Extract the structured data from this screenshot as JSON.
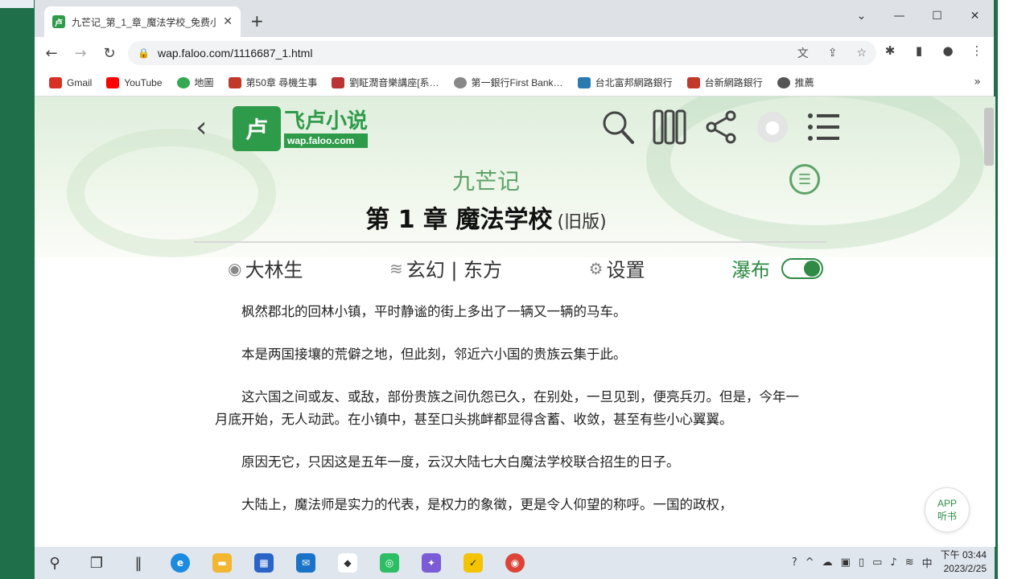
{
  "browser": {
    "tab_title": "九芒记_第_1_章_魔法学校_免费小",
    "url": "wap.faloo.com/1116687_1.html"
  },
  "bookmarks": [
    {
      "label": "Gmail",
      "color": "#d93025"
    },
    {
      "label": "YouTube",
      "color": "#ff0000"
    },
    {
      "label": "地圖",
      "color": "#34a853"
    },
    {
      "label": "第50章 尋機生事",
      "color": "#c0392b"
    },
    {
      "label": "劉眐潤音樂講座[系…",
      "color": "#b33"
    },
    {
      "label": "第一銀行First Bank…",
      "color": "#888"
    },
    {
      "label": "台北富邦網路銀行",
      "color": "#2a7ab0"
    },
    {
      "label": "台新網路銀行",
      "color": "#c0392b"
    },
    {
      "label": "推薦",
      "color": "#555"
    }
  ],
  "site": {
    "logo_text": "飞卢小说",
    "logo_domain": "wap.faloo.com",
    "logo_mark": "卢",
    "book_title": "九芒记",
    "chapter_title": "第 1 章 魔法学校",
    "chapter_suffix": "(旧版)",
    "author": "大林生",
    "genre": "玄幻 | 东方",
    "settings_label": "设置",
    "waterfall_label": "瀑布",
    "waterfall_on": true,
    "app_label_1": "APP",
    "app_label_2": "听书"
  },
  "paragraphs": [
    "枫然郡北的回林小镇，平时静谧的街上多出了一辆又一辆的马车。",
    "本是两国接壤的荒僻之地，但此刻，邻近六小国的贵族云集于此。",
    "这六国之间或友、或敌，部份贵族之间仇怨已久，在别处，一旦见到，便亮兵刃。但是，今年一月底开始，无人动武。在小镇中，甚至口头挑衅都显得含蓄、收敛，甚至有些小心翼翼。",
    "原因无它，只因这是五年一度，云汉大陆七大白魔法学校联合招生的日子。",
    "大陆上，魔法师是实力的代表，是权力的象徵，更是令人仰望的称呼。一国的政权，"
  ],
  "taskbar": {
    "time": "下午 03:44",
    "date": "2023/2/25",
    "ime": "中"
  }
}
